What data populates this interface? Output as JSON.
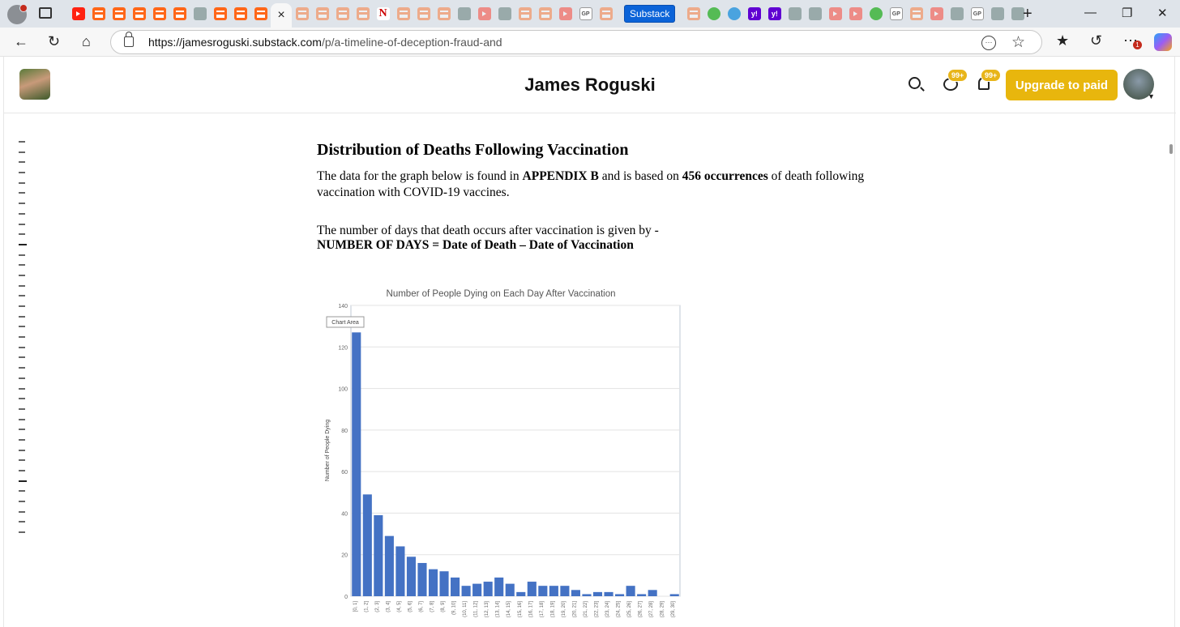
{
  "browser": {
    "active_tab_close": "×",
    "substack_tab_label": "Substack",
    "newtab_label": "+",
    "url_host": "https://jamesroguski.substack.com",
    "url_path": "/p/a-timeline-of-deception-fraud-and",
    "notif_count": "1"
  },
  "header": {
    "publication": "James Roguski",
    "chat_badge": "99+",
    "bell_badge": "99+",
    "upgrade_label": "Upgrade to paid"
  },
  "article": {
    "heading": "Distribution of Deaths Following Vaccination",
    "para1_a": "The data for the graph below is found in ",
    "para1_b": "APPENDIX B",
    "para1_c": " and is based on ",
    "para1_d": "456 occurrences",
    "para1_e": " of death following vaccination with COVID-19 vaccines.",
    "para2": "The number of days that death occurs after vaccination is given by -",
    "formula": "NUMBER OF DAYS = Date of Death – Date of Vaccination"
  },
  "chart_data": {
    "type": "bar",
    "title": "Number of People Dying on Each Day After Vaccination",
    "ylabel": "Number of People Dying",
    "tooltip": "Chart Area",
    "ylim": [
      0,
      140
    ],
    "yticks": [
      0,
      20,
      40,
      60,
      80,
      100,
      120,
      140
    ],
    "bar_color": "#4472c4",
    "categories": [
      "[0, 1]",
      "(1, 2]",
      "(2, 3]",
      "(3, 4]",
      "(4, 5]",
      "(5, 6]",
      "(6, 7]",
      "(7, 8]",
      "(8, 9]",
      "(9, 10]",
      "(10, 11]",
      "(11, 12]",
      "(12, 13]",
      "(13, 14]",
      "(14, 15]",
      "(15, 16]",
      "(16, 17]",
      "(17, 18]",
      "(18, 19]",
      "(19, 20]",
      "(20, 21]",
      "(21, 22]",
      "(22, 23]",
      "(23, 24]",
      "(24, 25]",
      "(25, 26]",
      "(26, 27]",
      "(27, 28]",
      "(28, 29]",
      "(29, 30]"
    ],
    "values": [
      127,
      49,
      39,
      29,
      24,
      19,
      16,
      13,
      12,
      9,
      5,
      6,
      7,
      9,
      6,
      2,
      7,
      5,
      5,
      5,
      3,
      1,
      2,
      2,
      1,
      5,
      1,
      3,
      0,
      1
    ]
  }
}
